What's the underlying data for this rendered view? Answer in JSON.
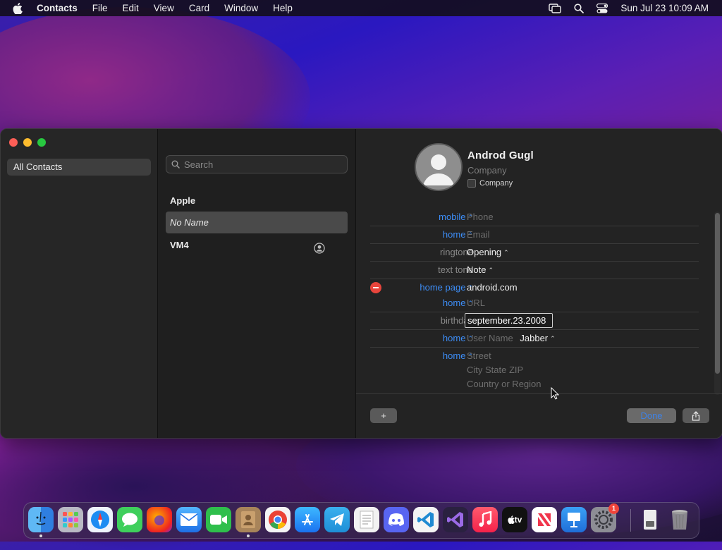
{
  "menubar": {
    "app": "Contacts",
    "items": [
      "File",
      "Edit",
      "View",
      "Card",
      "Window",
      "Help"
    ],
    "clock": "Sun Jul 23  10:09 AM"
  },
  "sidebar": {
    "group": "All Contacts"
  },
  "list": {
    "search_placeholder": "Search",
    "contacts": [
      "Apple",
      "No Name",
      "VM4"
    ]
  },
  "card": {
    "name": "Androd  Gugl",
    "company_placeholder": "Company",
    "company_checkbox": "Company",
    "fields": {
      "mobile_label": "mobile",
      "phone_placeholder": "Phone",
      "email_label": "home",
      "email_placeholder": "Email",
      "ringtone_label": "ringtone",
      "ringtone_value": "Opening",
      "texttone_label": "text tone",
      "texttone_value": "Note",
      "homepage_label": "home page",
      "homepage_value": "android.com",
      "url_label": "home",
      "url_placeholder": "URL",
      "birthday_label": "birthday",
      "birthday_value": "september.23.2008",
      "im_label": "home",
      "im_placeholder": "User Name",
      "im_service": "Jabber",
      "address_label": "home",
      "street_placeholder": "Street",
      "city_placeholder": "City State ZIP",
      "country_placeholder": "Country or Region"
    },
    "buttons": {
      "add": "+",
      "done": "Done"
    }
  },
  "dock": {
    "items": [
      "Finder",
      "Launchpad",
      "Safari",
      "Messages",
      "Firefox",
      "Mail",
      "FaceTime",
      "Contacts",
      "Chrome",
      "App Store",
      "Telegram",
      "TextEdit",
      "Discord",
      "VS Code",
      "Visual Studio",
      "Music",
      "TV",
      "News",
      "Keynote",
      "System Settings",
      "Downloads",
      "Trash"
    ],
    "settings_badge": "1",
    "tv_label": "tv"
  }
}
